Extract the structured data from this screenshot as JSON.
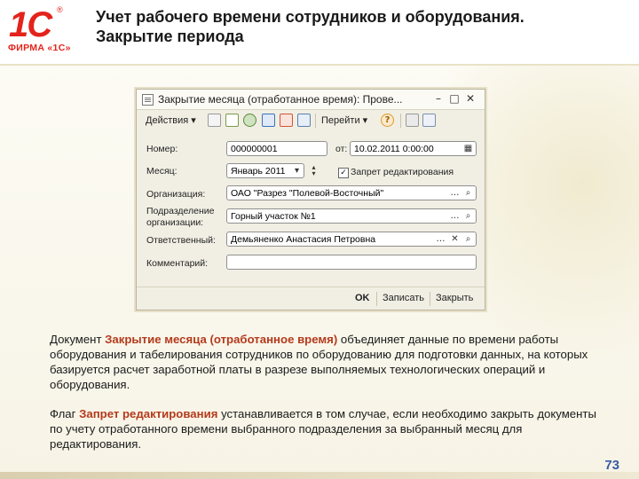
{
  "header": {
    "logo_mark": "1С",
    "logo_text": "ФИРМА «1С»",
    "title": "Учет рабочего времени сотрудников и оборудования. Закрытие периода"
  },
  "window": {
    "title": "Закрытие месяца (отработанное время): Прове...",
    "toolbar": {
      "actions": "Действия ▾",
      "goto": "Перейти ▾"
    },
    "fields": {
      "number_label": "Номер:",
      "number_value": "000000001",
      "from_label": "от:",
      "date_value": "10.02.2011  0:00:00",
      "month_label": "Месяц:",
      "month_value": "Январь 2011",
      "lock_label": "Запрет редактирования",
      "org_label": "Организация:",
      "org_value": "ОАО \"Разрез \"Полевой-Восточный\"",
      "dept_label_1": "Подразделение",
      "dept_label_2": "организации:",
      "dept_value": "Горный участок №1",
      "resp_label": "Ответственный:",
      "resp_value": "Демьяненко Анастасия Петровна",
      "comment_label": "Комментарий:"
    },
    "buttons": {
      "ok": "OK",
      "save": "Записать",
      "close": "Закрыть"
    }
  },
  "body": {
    "p1_before": "Документ ",
    "p1_highlight": "Закрытие месяца (отработанное время)",
    "p1_after": " объединяет данные по времени работы оборудования и табелирования сотрудников по оборудованию для подготовки данных, на которых базируется расчет заработной платы в разрезе выполняемых технологических операций и оборудования.",
    "p2_before": "Флаг ",
    "p2_highlight": "Запрет редактирования",
    "p2_after": " устанавливается в том случае, если необходимо закрыть документы по учету отработанного времени выбранного подразделения за выбранный месяц для редактирования."
  },
  "page_number": "73",
  "colors": {
    "brand": "#e3231b",
    "highlight": "#b43a1c",
    "page_number": "#3a5aa8"
  }
}
